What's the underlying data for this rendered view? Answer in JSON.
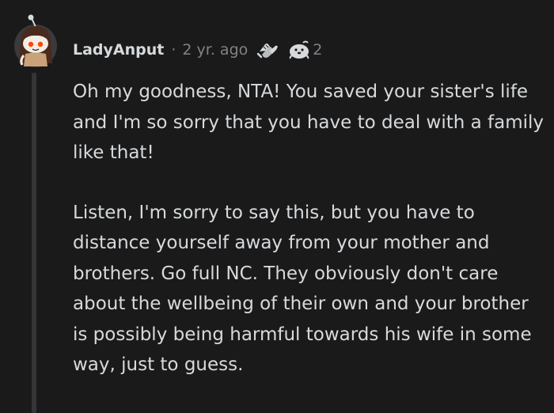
{
  "comment": {
    "username": "LadyAnput",
    "separator": "·",
    "time_ago": "2 yr. ago",
    "awards": [
      {
        "icon": "helpful-hands-award-icon"
      },
      {
        "icon": "wholesome-seal-award-icon",
        "count": "2"
      }
    ],
    "paragraphs": [
      "Oh my goodness, NTA! You saved your sister's life and I'm so sorry that you have to deal with a family like that!",
      "Listen, I'm sorry to say this, but you have to distance yourself away from your mother and brothers. Go full NC. They obviously don't care about the wellbeing of their own and your brother is possibly being harmful towards his wife in some way, just to guess."
    ]
  },
  "colors": {
    "background": "#1a1a1b",
    "text": "#d7dadc",
    "meta_text": "#818384",
    "thread_line": "#343536",
    "avatar_bg": "#3a3a3c",
    "avatar_hair": "#4a2a1c",
    "avatar_accent": "#ff4500"
  }
}
